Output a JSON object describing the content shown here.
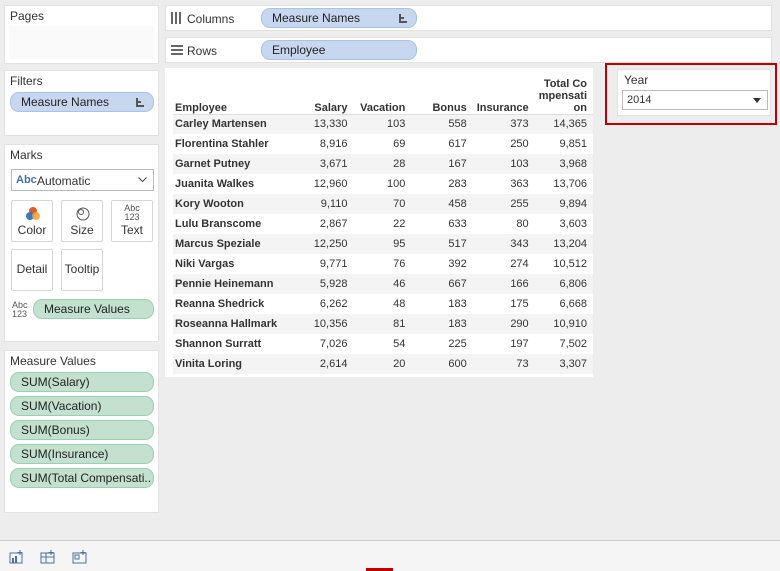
{
  "pages": {
    "title": "Pages"
  },
  "shelves": {
    "columns": {
      "label": "Columns",
      "pill": "Measure Names"
    },
    "rows": {
      "label": "Rows",
      "pill": "Employee"
    }
  },
  "filters": {
    "title": "Filters",
    "pill": "Measure Names"
  },
  "marks": {
    "title": "Marks",
    "mark_type": "Automatic",
    "type_icon": "Abc",
    "buttons": {
      "color": "Color",
      "size": "Size",
      "text": "Text",
      "detail": "Detail",
      "tooltip": "Tooltip"
    },
    "text_icon_top": "Abc",
    "text_icon_bottom": "123",
    "field_icon_top": "Abc",
    "field_icon_bottom": "123",
    "measure_values_pill": "Measure Values"
  },
  "measure_values": {
    "title": "Measure Values",
    "items": [
      "SUM(Salary)",
      "SUM(Vacation)",
      "SUM(Bonus)",
      "SUM(Insurance)",
      "SUM(Total Compensati.."
    ]
  },
  "year_filter": {
    "title": "Year",
    "value": "2014"
  },
  "table": {
    "headers": {
      "employee": "Employee",
      "salary": "Salary",
      "vacation": "Vacation",
      "bonus": "Bonus",
      "insurance": "Insurance",
      "total_line1": "Total Co",
      "total_line2": "mpensati",
      "total_line3": "on"
    },
    "rows": [
      [
        "Carley Martensen",
        "13,330",
        "103",
        "558",
        "373",
        "14,365"
      ],
      [
        "Florentina Stahler",
        "8,916",
        "69",
        "617",
        "250",
        "9,851"
      ],
      [
        "Garnet Putney",
        "3,671",
        "28",
        "167",
        "103",
        "3,968"
      ],
      [
        "Juanita Walkes",
        "12,960",
        "100",
        "283",
        "363",
        "13,706"
      ],
      [
        "Kory Wooton",
        "9,110",
        "70",
        "458",
        "255",
        "9,894"
      ],
      [
        "Lulu Branscome",
        "2,867",
        "22",
        "633",
        "80",
        "3,603"
      ],
      [
        "Marcus Speziale",
        "12,250",
        "95",
        "517",
        "343",
        "13,204"
      ],
      [
        "Niki Vargas",
        "9,771",
        "76",
        "392",
        "274",
        "10,512"
      ],
      [
        "Pennie Heinemann",
        "5,928",
        "46",
        "667",
        "166",
        "6,806"
      ],
      [
        "Reanna Shedrick",
        "6,262",
        "48",
        "183",
        "175",
        "6,668"
      ],
      [
        "Roseanna Hallmark",
        "10,356",
        "81",
        "183",
        "290",
        "10,910"
      ],
      [
        "Shannon Surratt",
        "7,026",
        "54",
        "225",
        "197",
        "7,502"
      ],
      [
        "Vinita Loring",
        "2,614",
        "20",
        "600",
        "73",
        "3,307"
      ]
    ]
  },
  "colors": {
    "blue_pill": "#c7d7ef",
    "green_pill": "#c4e0cf",
    "highlight": "#c00000"
  }
}
